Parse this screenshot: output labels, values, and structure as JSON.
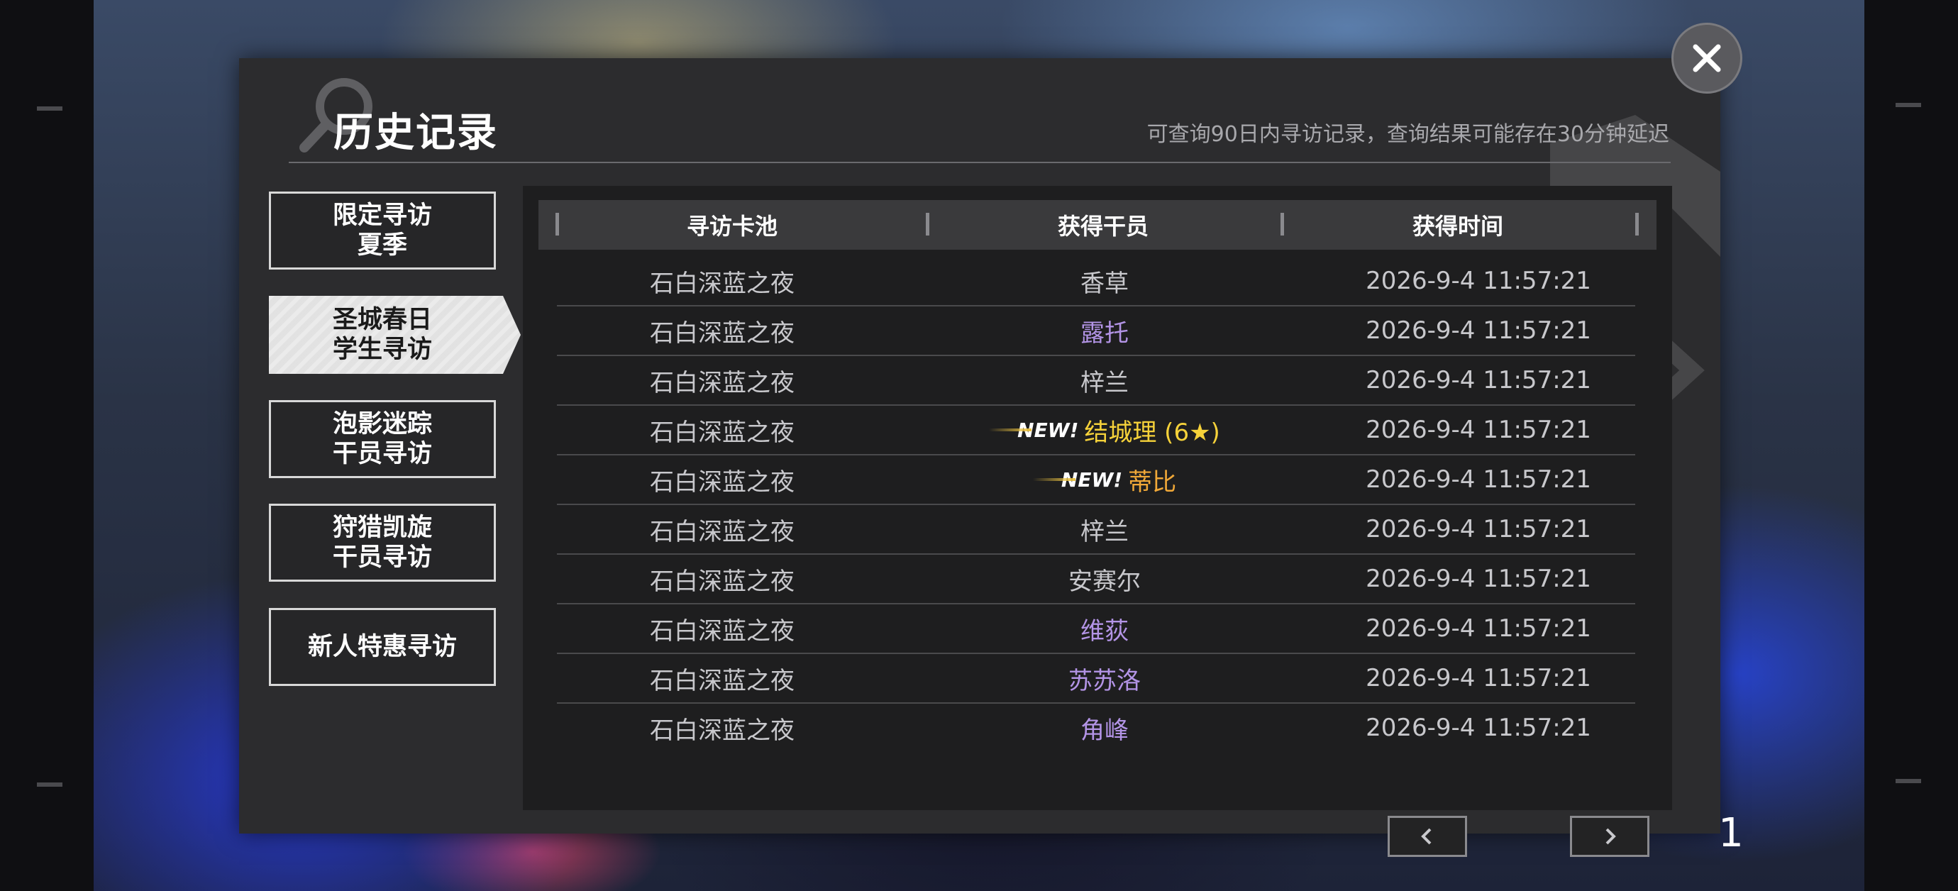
{
  "dialog": {
    "title": "历史记录",
    "notice": "可查询90日内寻访记录，查询结果可能存在30分钟延迟",
    "close_icon": "close-icon"
  },
  "tabs": [
    {
      "label": "限定寻访\n夏季",
      "active": false
    },
    {
      "label": "圣城春日\n学生寻访",
      "active": true
    },
    {
      "label": "泡影迷踪\n干员寻访",
      "active": false
    },
    {
      "label": "狩猎凯旋\n干员寻访",
      "active": false
    },
    {
      "label": "新人特惠寻访",
      "active": false
    }
  ],
  "table": {
    "headers": [
      "寻访卡池",
      "获得干员",
      "获得时间"
    ],
    "rows": [
      {
        "pool": "石白深蓝之夜",
        "operator": "香草",
        "rarity_class": "r3",
        "new_label": "",
        "time": "2026-9-4 11:57:21"
      },
      {
        "pool": "石白深蓝之夜",
        "operator": "露托",
        "rarity_class": "r4",
        "new_label": "",
        "time": "2026-9-4 11:57:21"
      },
      {
        "pool": "石白深蓝之夜",
        "operator": "梓兰",
        "rarity_class": "r3",
        "new_label": "",
        "time": "2026-9-4 11:57:21"
      },
      {
        "pool": "石白深蓝之夜",
        "operator": "结城理 (6★)",
        "rarity_class": "r6",
        "new_label": "NEW!",
        "time": "2026-9-4 11:57:21"
      },
      {
        "pool": "石白深蓝之夜",
        "operator": "蒂比",
        "rarity_class": "r5",
        "new_label": "NEW!",
        "time": "2026-9-4 11:57:21"
      },
      {
        "pool": "石白深蓝之夜",
        "operator": "梓兰",
        "rarity_class": "r3",
        "new_label": "",
        "time": "2026-9-4 11:57:21"
      },
      {
        "pool": "石白深蓝之夜",
        "operator": "安赛尔",
        "rarity_class": "r3",
        "new_label": "",
        "time": "2026-9-4 11:57:21"
      },
      {
        "pool": "石白深蓝之夜",
        "operator": "维荻",
        "rarity_class": "r4",
        "new_label": "",
        "time": "2026-9-4 11:57:21"
      },
      {
        "pool": "石白深蓝之夜",
        "operator": "苏苏洛",
        "rarity_class": "r4",
        "new_label": "",
        "time": "2026-9-4 11:57:21"
      },
      {
        "pool": "石白深蓝之夜",
        "operator": "角峰",
        "rarity_class": "r4",
        "new_label": "",
        "time": "2026-9-4 11:57:21"
      }
    ]
  },
  "pagination": {
    "current_page": "1",
    "prev_icon": "chevron-left-icon",
    "next_icon": "chevron-right-icon"
  },
  "colors": {
    "rarity_3": "#c8c8cc",
    "rarity_4": "#b394e6",
    "rarity_5": "#f0a838",
    "rarity_6": "#f6d23a"
  }
}
